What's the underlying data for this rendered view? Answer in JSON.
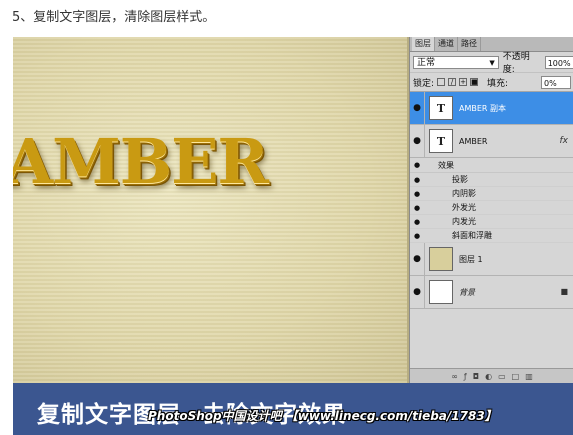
{
  "caption": "5、复制文字图层，清除图层样式。",
  "canvas": {
    "text": "AMBER"
  },
  "panel": {
    "tabs": [
      "图层",
      "通道",
      "路径"
    ],
    "blend_mode": "正常",
    "opacity_label": "不透明度:",
    "opacity_value": "100%",
    "lock_label": "锁定:",
    "fill_label": "填充:",
    "fill_value": "0%",
    "layers": [
      {
        "name": "AMBER 副本",
        "thumb": "T",
        "selected": true
      },
      {
        "name": "AMBER",
        "thumb": "T",
        "fx": "fx"
      },
      {
        "name": "图层 1"
      },
      {
        "name": "背景"
      }
    ],
    "effects_label": "效果",
    "effects": [
      "投影",
      "内阴影",
      "外发光",
      "内发光",
      "斜面和浮雕"
    ]
  },
  "banner": {
    "title": "复制文字图层--去除文字效果",
    "watermark": "PhotoShop中国设计吧 【www.linecg.com/tieba/1783】"
  },
  "colors": {
    "accent": "#3d8ee6",
    "banner": "#3b5690",
    "gold": "#c99a12"
  }
}
